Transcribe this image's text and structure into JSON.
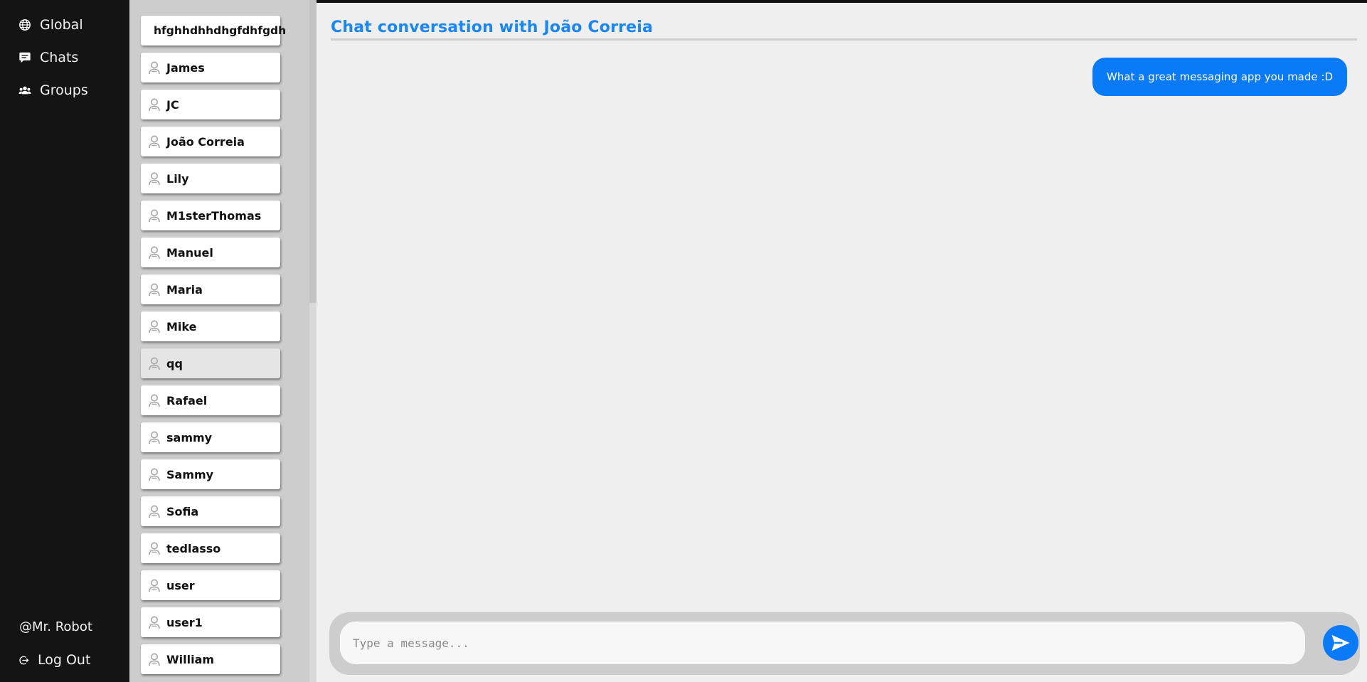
{
  "nav": {
    "items": [
      {
        "label": "Global",
        "icon": "globe-icon"
      },
      {
        "label": "Chats",
        "icon": "chat-icon"
      },
      {
        "label": "Groups",
        "icon": "groups-icon"
      }
    ],
    "username": "@Mr. Robot",
    "logout": "Log Out"
  },
  "contacts": [
    {
      "name": "hfghhdhhdhgfdhfgdh",
      "icon": "none"
    },
    {
      "name": "James",
      "icon": "user-icon"
    },
    {
      "name": "JC",
      "icon": "user-icon"
    },
    {
      "name": "João Correia",
      "icon": "user-icon"
    },
    {
      "name": "Lily",
      "icon": "user-icon"
    },
    {
      "name": "M1sterThomas",
      "icon": "user-icon"
    },
    {
      "name": "Manuel",
      "icon": "user-icon"
    },
    {
      "name": "Maria",
      "icon": "user-icon"
    },
    {
      "name": "Mike",
      "icon": "user-icon"
    },
    {
      "name": "qq",
      "icon": "user-icon",
      "active": true
    },
    {
      "name": "Rafael",
      "icon": "user-icon"
    },
    {
      "name": "sammy",
      "icon": "user-icon"
    },
    {
      "name": "Sammy",
      "icon": "user-icon"
    },
    {
      "name": "Sofia",
      "icon": "user-icon"
    },
    {
      "name": "tedlasso",
      "icon": "user-icon"
    },
    {
      "name": "user",
      "icon": "user-icon"
    },
    {
      "name": "user1",
      "icon": "user-icon"
    },
    {
      "name": "William",
      "icon": "user-icon"
    }
  ],
  "chat": {
    "title": "Chat conversation with João Correia",
    "messages": [
      {
        "text": "What a great messaging app you made :D",
        "sender": "me"
      }
    ],
    "input_placeholder": "Type a message...",
    "input_value": ""
  },
  "colors": {
    "accent": "#0b7af7",
    "title": "#1a86f0",
    "sidebar": "#141414",
    "contacts_panel": "#cdcdcd",
    "chat_bg": "#efefef"
  }
}
